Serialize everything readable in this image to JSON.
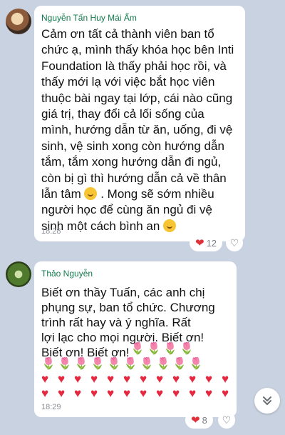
{
  "messages": [
    {
      "sender": "Nguyễn Tấn Huy Mái Ấm",
      "lines": [
        "Cảm ơn tất cả thành viên ban tổ",
        "chức ạ, mình thấy khóa học bên Inti",
        "Foundation là thấy phải học rồi, và",
        "thấy mới lạ với việc bắt học viên",
        "thuộc bài ngay tại lớp, cái nào cũng",
        "giá trị, thay đổi cả lối sống của",
        "mình, hướng dẫn từ ăn, uống, đi vệ",
        "sinh, vệ sinh xong còn hướng dẫn",
        "tắm, tắm xong hướng dẫn đi ngủ,",
        "còn bị gì thì hướng dẫn cả về thân",
        "lẫn tâm",
        ". Mong sẽ sớm nhiều",
        "người học để cùng ăn ngủ đi vệ",
        "sinh một cách bình an"
      ],
      "time": "18:28",
      "reaction_count": "12",
      "icons": {
        "reaction": "heart-icon",
        "like": "heart-outline-icon",
        "inline_emoji": "smiley-icon"
      }
    },
    {
      "sender": "Thảo Nguyễn",
      "lines": [
        "Biết ơn thầy Tuấn, các anh chị",
        "phụng sự, ban tổ chức. Chương",
        "trình rất hay và ý nghĩa. Rất",
        "lợi lạc cho mọi người. Biết ơn!",
        "Biết ơn! Biết ơn!"
      ],
      "time": "18:29",
      "reaction_count": "8",
      "icons": {
        "reaction": "heart-icon",
        "like": "heart-outline-icon",
        "emoji_row": [
          "tulip-icon",
          "heart-icon"
        ]
      }
    }
  ],
  "scroll_button": {
    "icon": "double-chevron-down-icon"
  },
  "colors": {
    "background": "#c9d2e0",
    "sender_name": "#137a4e",
    "heart": "#e5283f"
  }
}
